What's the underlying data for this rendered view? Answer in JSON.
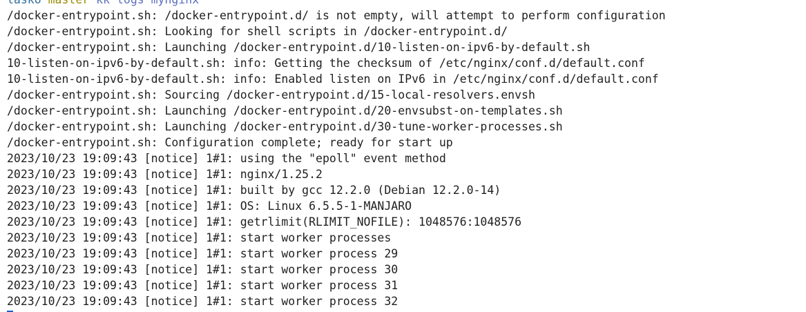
{
  "terminal": {
    "prompt_top": {
      "user": "lasko",
      "branch": "master",
      "command": "kk logs mynginx"
    },
    "lines": [
      "/docker-entrypoint.sh: /docker-entrypoint.d/ is not empty, will attempt to perform configuration",
      "/docker-entrypoint.sh: Looking for shell scripts in /docker-entrypoint.d/",
      "/docker-entrypoint.sh: Launching /docker-entrypoint.d/10-listen-on-ipv6-by-default.sh",
      "10-listen-on-ipv6-by-default.sh: info: Getting the checksum of /etc/nginx/conf.d/default.conf",
      "10-listen-on-ipv6-by-default.sh: info: Enabled listen on IPv6 in /etc/nginx/conf.d/default.conf",
      "/docker-entrypoint.sh: Sourcing /docker-entrypoint.d/15-local-resolvers.envsh",
      "/docker-entrypoint.sh: Launching /docker-entrypoint.d/20-envsubst-on-templates.sh",
      "/docker-entrypoint.sh: Launching /docker-entrypoint.d/30-tune-worker-processes.sh",
      "/docker-entrypoint.sh: Configuration complete; ready for start up",
      "2023/10/23 19:09:43 [notice] 1#1: using the \"epoll\" event method",
      "2023/10/23 19:09:43 [notice] 1#1: nginx/1.25.2",
      "2023/10/23 19:09:43 [notice] 1#1: built by gcc 12.2.0 (Debian 12.2.0-14)",
      "2023/10/23 19:09:43 [notice] 1#1: OS: Linux 6.5.5-1-MANJARO",
      "2023/10/23 19:09:43 [notice] 1#1: getrlimit(RLIMIT_NOFILE): 1048576:1048576",
      "2023/10/23 19:09:43 [notice] 1#1: start worker processes",
      "2023/10/23 19:09:43 [notice] 1#1: start worker process 29",
      "2023/10/23 19:09:43 [notice] 1#1: start worker process 30",
      "2023/10/23 19:09:43 [notice] 1#1: start worker process 31",
      "2023/10/23 19:09:43 [notice] 1#1: start worker process 32"
    ]
  }
}
